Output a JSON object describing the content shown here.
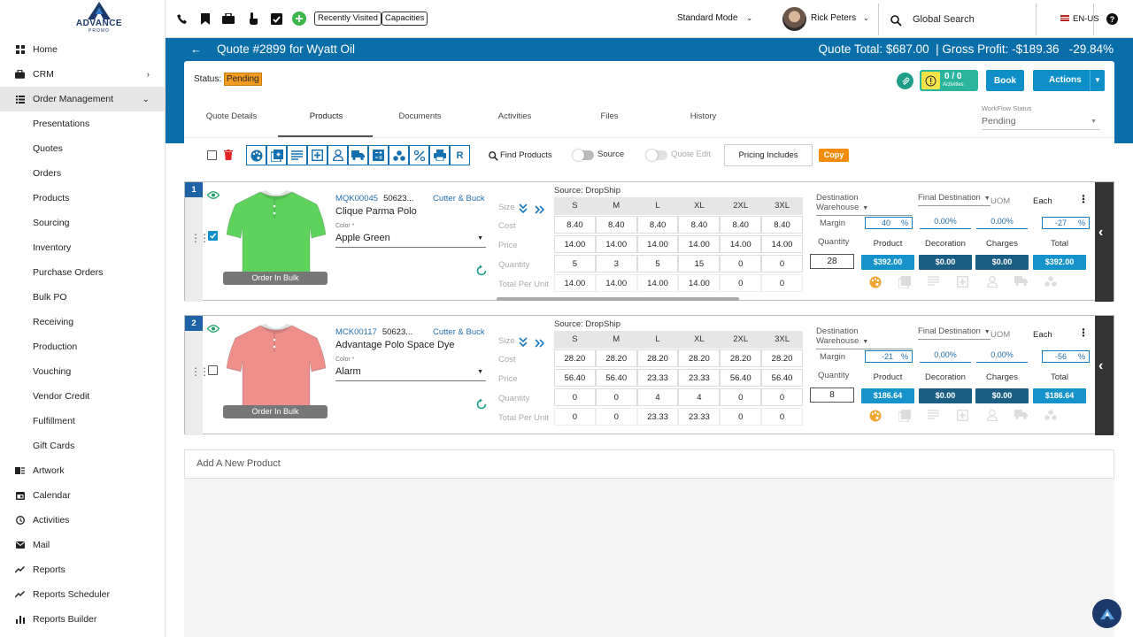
{
  "logo": {
    "line1": "ADVANCE",
    "line2": "PROMO"
  },
  "nav": [
    {
      "label": "Home",
      "icon": "grid-icon",
      "sub": false
    },
    {
      "label": "CRM",
      "icon": "briefcase-icon",
      "sub": false,
      "chev": "›"
    },
    {
      "label": "Order Management",
      "icon": "list-icon",
      "sub": false,
      "chev": "⌄",
      "active": true
    },
    {
      "label": "Presentations",
      "sub": true
    },
    {
      "label": "Quotes",
      "sub": true
    },
    {
      "label": "Orders",
      "sub": true
    },
    {
      "label": "Products",
      "sub": true
    },
    {
      "label": "Sourcing",
      "sub": true
    },
    {
      "label": "Inventory",
      "sub": true
    },
    {
      "label": "Purchase Orders",
      "sub": true
    },
    {
      "label": "Bulk PO",
      "sub": true
    },
    {
      "label": "Receiving",
      "sub": true
    },
    {
      "label": "Production",
      "sub": true
    },
    {
      "label": "Vouching",
      "sub": true
    },
    {
      "label": "Vendor Credit",
      "sub": true
    },
    {
      "label": "Fulfillment",
      "sub": true
    },
    {
      "label": "Gift Cards",
      "sub": true
    },
    {
      "label": "Artwork",
      "icon": "artwork-icon",
      "sub": false
    },
    {
      "label": "Calendar",
      "icon": "calendar-icon",
      "sub": false
    },
    {
      "label": "Activities",
      "icon": "clock-icon",
      "sub": false
    },
    {
      "label": "Mail",
      "icon": "mail-icon",
      "sub": false
    },
    {
      "label": "Reports",
      "icon": "trend-icon",
      "sub": false
    },
    {
      "label": "Reports Scheduler",
      "icon": "trend-icon",
      "sub": false
    },
    {
      "label": "Reports Builder",
      "icon": "bar-chart-icon",
      "sub": false
    }
  ],
  "topbar": {
    "recent": "Recently Visited",
    "capacities": "Capacities",
    "mode": "Standard Mode",
    "user": "Rick Peters",
    "search": "Global Search",
    "lang": "EN-US"
  },
  "quote": {
    "title": "Quote #2899 for Wyatt Oil",
    "totals": "Quote Total: $687.00  | Gross Profit: -$189.36   -29.84%",
    "status_label": "Status:",
    "status": "Pending",
    "activities_count": "0 / 0",
    "activities_label": "Activities",
    "book": "Book",
    "actions": "Actions"
  },
  "tabs": [
    "Quote Details",
    "Products",
    "Documents",
    "Activities",
    "Files",
    "History"
  ],
  "workflow": {
    "label": "WorkFlow Status",
    "value": "Pending"
  },
  "toolbar": {
    "find": "Find Products",
    "source": "Source",
    "quote_edit": "Quote Edit",
    "pricing": "Pricing Includes",
    "copy": "Copy"
  },
  "rowlabels": {
    "size": "Size",
    "cost": "Cost",
    "price": "Price",
    "quantity": "Quantity",
    "tpu": "Total Per Unit"
  },
  "right_labels": {
    "dest_wh": "Destination Warehouse",
    "final_dest": "Final Destination",
    "uom": "UOM",
    "each": "Each",
    "margin": "Margin",
    "quantity": "Quantity",
    "product": "Product",
    "decoration": "Decoration",
    "charges": "Charges",
    "total": "Total",
    "pct": "%"
  },
  "products": [
    {
      "num": "1",
      "code": "MQK00045",
      "sku": "50623...",
      "vendor": "Cutter & Buck",
      "name": "Clique Parma Polo",
      "color_label": "Color *",
      "color": "Apple Green",
      "bulk": "Order In Bulk",
      "source": "Source: DropShip",
      "checked": true,
      "sizes": [
        "S",
        "M",
        "L",
        "XL",
        "2XL",
        "3XL"
      ],
      "cost": [
        "8.40",
        "8.40",
        "8.40",
        "8.40",
        "8.40",
        "8.40"
      ],
      "price": [
        "14.00",
        "14.00",
        "14.00",
        "14.00",
        "14.00",
        "14.00"
      ],
      "qty": [
        "5",
        "3",
        "5",
        "15",
        "0",
        "0"
      ],
      "tpu": [
        "14.00",
        "14.00",
        "14.00",
        "14.00",
        "0",
        "0"
      ],
      "margin_product": "40",
      "margin_deco": "0.00%",
      "margin_charges": "0.00%",
      "margin_total": "-27",
      "quantity": "28",
      "product_total": "$392.00",
      "deco_total": "$0.00",
      "charges_total": "$0.00",
      "grand_total": "$392.00",
      "shirt_color": "#5ed35c"
    },
    {
      "num": "2",
      "code": "MCK00117",
      "sku": "50623...",
      "vendor": "Cutter & Buck",
      "name": "Advantage Polo Space Dye",
      "color_label": "Color *",
      "color": "Alarm",
      "bulk": "Order In Bulk",
      "source": "Source: DropShip",
      "checked": false,
      "sizes": [
        "S",
        "M",
        "L",
        "XL",
        "2XL",
        "3XL"
      ],
      "cost": [
        "28.20",
        "28.20",
        "28.20",
        "28.20",
        "28.20",
        "28.20"
      ],
      "price": [
        "56.40",
        "56.40",
        "23.33",
        "23.33",
        "56.40",
        "56.40"
      ],
      "qty": [
        "0",
        "0",
        "4",
        "4",
        "0",
        "0"
      ],
      "tpu": [
        "0",
        "0",
        "23.33",
        "23.33",
        "0",
        "0"
      ],
      "margin_product": "-21",
      "margin_deco": "0.00%",
      "margin_charges": "0.00%",
      "margin_total": "-56",
      "quantity": "8",
      "product_total": "$186.64",
      "deco_total": "$0.00",
      "charges_total": "$0.00",
      "grand_total": "$186.64",
      "shirt_color": "#ee8f8c"
    }
  ],
  "add_new": "Add A New Product"
}
